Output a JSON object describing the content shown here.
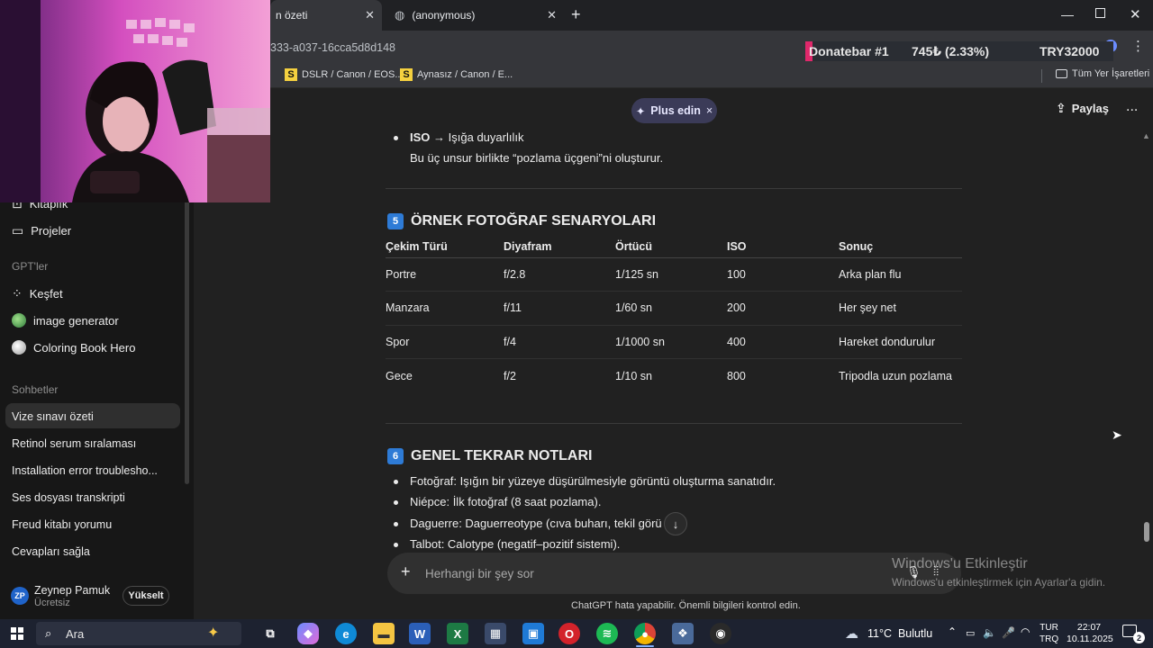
{
  "browser": {
    "tabs": [
      {
        "label": "n özeti"
      },
      {
        "label": "(anonymous)"
      }
    ],
    "new_tab_label": "+",
    "address_text": "333-a037-16cca5d8d148",
    "bookmarks": [
      {
        "icon_letter": "S",
        "label": "DSLR / Canon / EOS..."
      },
      {
        "icon_letter": "S",
        "label": "Aynasız / Canon / E..."
      }
    ],
    "all_bookmarks_label": "Tüm Yer İşaretleri"
  },
  "donation": {
    "title": "Donatebar #1",
    "amount": "745₺ (2.33%)",
    "goal": "TRY32000",
    "progress_percent": 2.33
  },
  "sidebar": {
    "library_label": "Kitaplık",
    "projects_label": "Projeler",
    "gpts_heading": "GPT'ler",
    "gpts": [
      {
        "label": "Keşfet",
        "icon": "grid-icon"
      },
      {
        "label": "image generator",
        "icon": "image-generator-avatar-icon"
      },
      {
        "label": "Coloring Book Hero",
        "icon": "coloring-book-avatar-icon"
      }
    ],
    "chats_heading": "Sohbetler",
    "chats": [
      "Vize sınavı özeti",
      "Retinol serum sıralaması",
      "Installation error troublesho...",
      "Ses dosyası transkripti",
      "Freud kitabı yorumu",
      "Cevapları sağla"
    ],
    "user": {
      "initials": "ZP",
      "name": "Zeynep Pamuk",
      "plan": "Ücretsiz",
      "upgrade_label": "Yükselt",
      "avatar_color": "#1f63c9"
    }
  },
  "header": {
    "plus_label": "Plus edin",
    "plus_close": "×",
    "share_label": "Paylaş",
    "more_label": "..."
  },
  "content": {
    "iso_bold": "ISO",
    "iso_text": "→ Işığa duyarlılık",
    "exposure_note": "Bu üç unsur birlikte “pozlama üçgeni”ni oluşturur.",
    "section5": {
      "number": "5",
      "title": "ÖRNEK FOTOĞRAF SENARYOLARI",
      "columns": [
        "Çekim Türü",
        "Diyafram",
        "Örtücü",
        "ISO",
        "Sonuç"
      ],
      "rows": [
        [
          "Portre",
          "f/2.8",
          "1/125 sn",
          "100",
          "Arka plan flu"
        ],
        [
          "Manzara",
          "f/11",
          "1/60 sn",
          "200",
          "Her şey net"
        ],
        [
          "Spor",
          "f/4",
          "1/1000 sn",
          "400",
          "Hareket dondurulur"
        ],
        [
          "Gece",
          "f/2",
          "1/10 sn",
          "800",
          "Tripodla uzun pozlama"
        ]
      ]
    },
    "section6": {
      "number": "6",
      "title": "GENEL TEKRAR NOTLARI",
      "bullets": [
        "Fotoğraf: Işığın bir yüzeye düşürülmesiyle görüntü oluşturma sanatıdır.",
        "Niépce: İlk fotoğraf (8 saat pozlama).",
        "Daguerre: Daguerreotype (cıva buharı, tekil görü",
        "Talbot: Calotype (negatif–pozitif sistemi)."
      ],
      "bullet3_tail": "."
    }
  },
  "composer": {
    "placeholder": "Herhangi bir şey sor",
    "plus_label": "+"
  },
  "disclaimer": "ChatGPT hata yapabilir. Önemli bilgileri kontrol edin.",
  "windows_activation": {
    "title": "Windows'u Etkinleştir",
    "subtitle": "Windows'u etkinleştirmek için Ayarlar'a gidin."
  },
  "taskbar": {
    "search_label": "Ara",
    "weather": "11°C  Bulutlu",
    "lang_line1": "TUR",
    "lang_line2": "TRQ",
    "time": "22:07",
    "date": "10.11.2025",
    "notification_count": "2"
  }
}
